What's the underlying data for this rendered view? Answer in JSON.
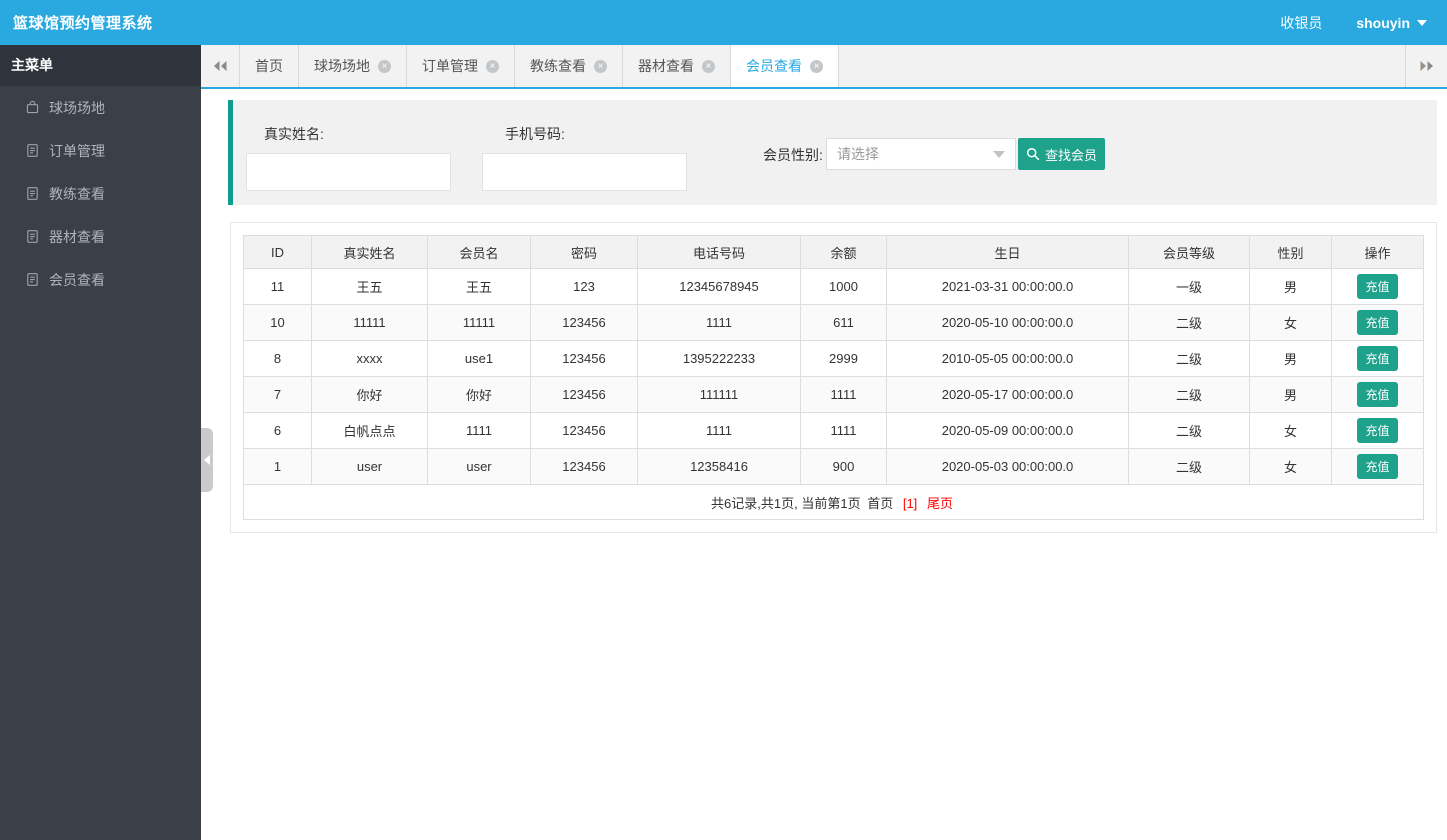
{
  "app": {
    "title": "篮球馆预约管理系统"
  },
  "header": {
    "role": "收银员",
    "username": "shouyin"
  },
  "sidebar": {
    "title": "主菜单",
    "items": [
      {
        "label": "球场场地",
        "icon": "bag-icon"
      },
      {
        "label": "订单管理",
        "icon": "document-icon"
      },
      {
        "label": "教练查看",
        "icon": "document-icon"
      },
      {
        "label": "器材查看",
        "icon": "document-icon"
      },
      {
        "label": "会员查看",
        "icon": "document-icon"
      }
    ]
  },
  "tabs": {
    "items": [
      {
        "label": "首页",
        "closable": false,
        "active": false
      },
      {
        "label": "球场场地",
        "closable": true,
        "active": false
      },
      {
        "label": "订单管理",
        "closable": true,
        "active": false
      },
      {
        "label": "教练查看",
        "closable": true,
        "active": false
      },
      {
        "label": "器材查看",
        "closable": true,
        "active": false
      },
      {
        "label": "会员查看",
        "closable": true,
        "active": true
      }
    ]
  },
  "search": {
    "real_name_label": "真实姓名:",
    "real_name_value": "",
    "phone_label": "手机号码:",
    "phone_value": "",
    "gender_label": "会员性别:",
    "gender_placeholder": "请选择",
    "search_button": "查找会员"
  },
  "table": {
    "columns": [
      "ID",
      "真实姓名",
      "会员名",
      "密码",
      "电话号码",
      "余额",
      "生日",
      "会员等级",
      "性别",
      "操作"
    ],
    "action_label": "充值",
    "rows": [
      [
        "11",
        "王五",
        "王五",
        "123",
        "12345678945",
        "1000",
        "2021-03-31 00:00:00.0",
        "一级",
        "男"
      ],
      [
        "10",
        "11111",
        "11111",
        "123456",
        "1111",
        "611",
        "2020-05-10 00:00:00.0",
        "二级",
        "女"
      ],
      [
        "8",
        "xxxx",
        "use1",
        "123456",
        "1395222233",
        "2999",
        "2010-05-05 00:00:00.0",
        "二级",
        "男"
      ],
      [
        "7",
        "你好",
        "你好",
        "123456",
        "111111",
        "1111",
        "2020-05-17 00:00:00.0",
        "二级",
        "男"
      ],
      [
        "6",
        "白帆点点",
        "1111",
        "123456",
        "1111",
        "1111",
        "2020-05-09 00:00:00.0",
        "二级",
        "女"
      ],
      [
        "1",
        "user",
        "user",
        "123456",
        "12358416",
        "900",
        "2020-05-03 00:00:00.0",
        "二级",
        "女"
      ]
    ]
  },
  "pagination": {
    "summary": "共6记录,共1页, 当前第1页",
    "first": "首页",
    "current": "[1]",
    "last": "尾页"
  },
  "colors": {
    "accent_blue": "#29a9e0",
    "accent_teal": "#1fa28c",
    "panel_border_teal": "#0f9b8e",
    "sidebar_bg": "#3b4048",
    "sidebar_header_bg": "#2f333b",
    "pager_active_red": "#ff0000"
  }
}
